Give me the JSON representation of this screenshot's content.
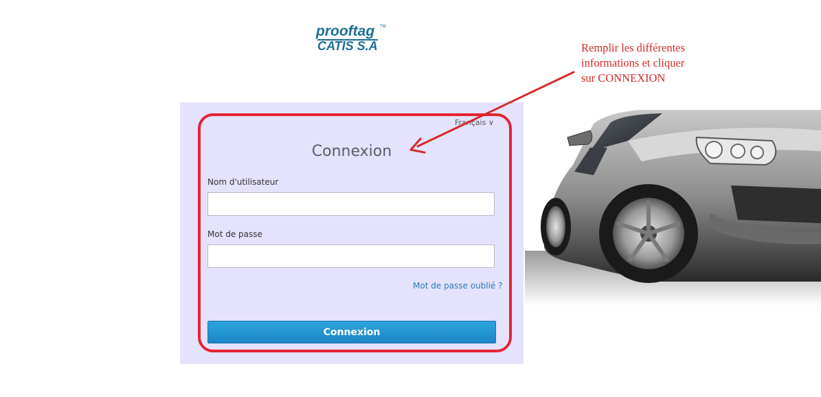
{
  "logo": {
    "line1": "prooftag",
    "tm": "TM",
    "line2": "CATIS S.A"
  },
  "annotation": {
    "lines": [
      "Remplir les différentes",
      "informations et cliquer",
      "sur CONNEXION"
    ],
    "color": "#d42a2a"
  },
  "login": {
    "language": "Français ∨",
    "title": "Connexion",
    "username_label": "Nom d'utilisateur",
    "username_value": "",
    "password_label": "Mot de passe",
    "password_value": "",
    "forgot_link": "Mot de passe oublié ?",
    "submit_label": "Connexion",
    "panel_color": "#e4e2fd",
    "accent_color": "#1c86c4",
    "highlight_color": "#e32434"
  },
  "car_image": {
    "icon": "car-photo"
  }
}
